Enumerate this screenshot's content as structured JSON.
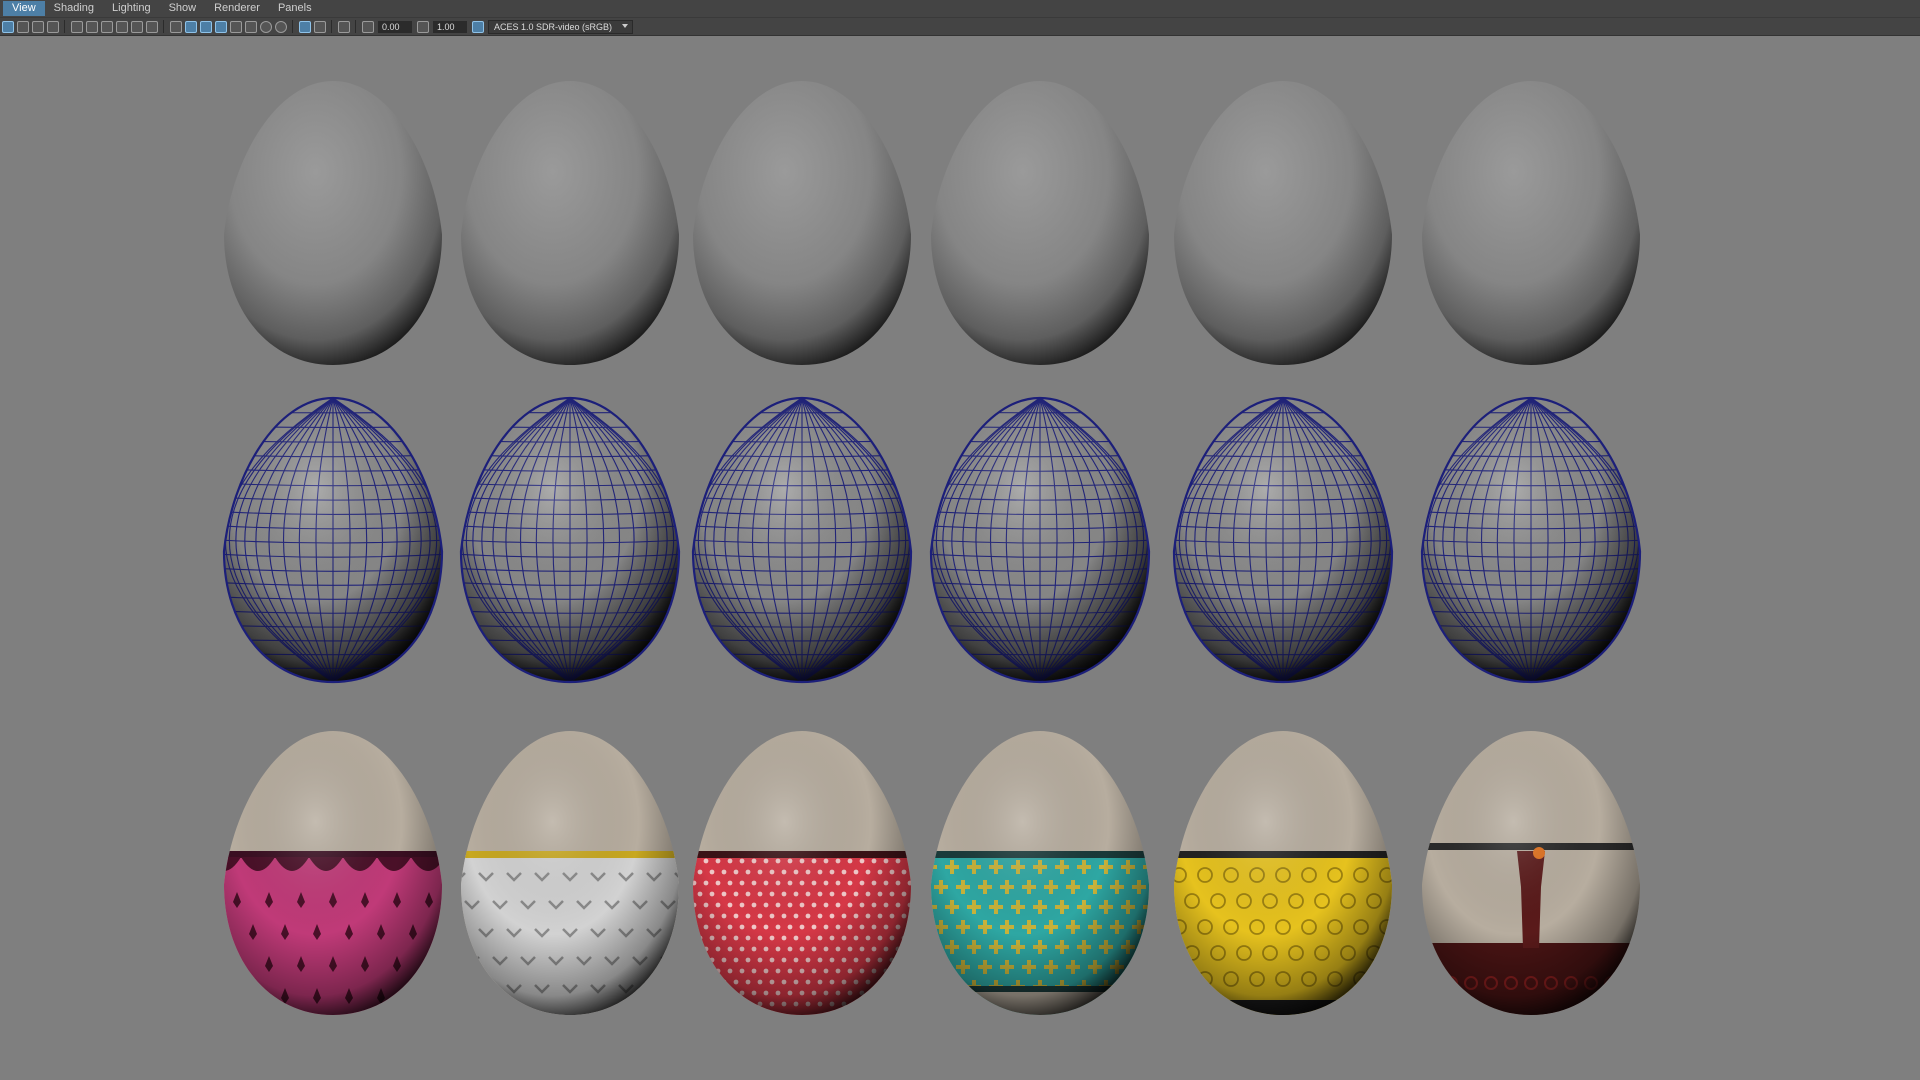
{
  "menubar": {
    "items": [
      "View",
      "Shading",
      "Lighting",
      "Show",
      "Renderer",
      "Panels"
    ]
  },
  "toolbar": {
    "exposure_value": "0.00",
    "gamma_value": "1.00",
    "color_space": "ACES 1.0 SDR-video (sRGB)",
    "icons": [
      "select-camera-icon",
      "camera-attributes-icon",
      "bookmarks-icon",
      "image-plane-icon",
      "grid-icon",
      "film-gate-icon",
      "resolution-gate-icon",
      "gate-mask-icon",
      "field-chart-icon",
      "safe-action-icon",
      "wireframe-icon",
      "smooth-shade-icon",
      "wireframe-on-shaded-icon",
      "textured-icon",
      "lighting-icon",
      "shadows-icon",
      "ambient-occlusion-icon",
      "motion-blur-icon",
      "isolate-select-icon",
      "xray-icon",
      "xray-joints-icon",
      "exposure-icon",
      "gamma-icon"
    ]
  },
  "viewport": {
    "rows": [
      {
        "mode": "smooth-shaded",
        "eggs": 6
      },
      {
        "mode": "wireframe-on-shaded",
        "eggs": 6
      },
      {
        "mode": "textured",
        "eggs": [
          {
            "pattern": "fleur",
            "band": "#c03a78",
            "accent": "#4a1028",
            "stripe": "#3a0f22"
          },
          {
            "pattern": "chevron",
            "band": "#d2d2d2",
            "accent": "#8a8a8a",
            "stripe": "#c8a820"
          },
          {
            "pattern": "dots",
            "band": "#d63847",
            "accent": "#f0c8c8",
            "stripe": "#3a1216"
          },
          {
            "pattern": "cross",
            "band": "#2ea7a3",
            "accent": "#c7b23a",
            "stripe": "#1a3a3a"
          },
          {
            "pattern": "flower",
            "band": "#e6c21e",
            "accent": "#9b8010",
            "stripe": "#222222"
          },
          {
            "pattern": "swirl",
            "band": "#4a1414",
            "accent": "#8a1f1f",
            "stripe": "#2a2a2a"
          }
        ]
      }
    ],
    "colors": {
      "background": "#7f7f7f",
      "egg_shell": "#b7ad9f",
      "wire": "#1c1f7a"
    }
  }
}
